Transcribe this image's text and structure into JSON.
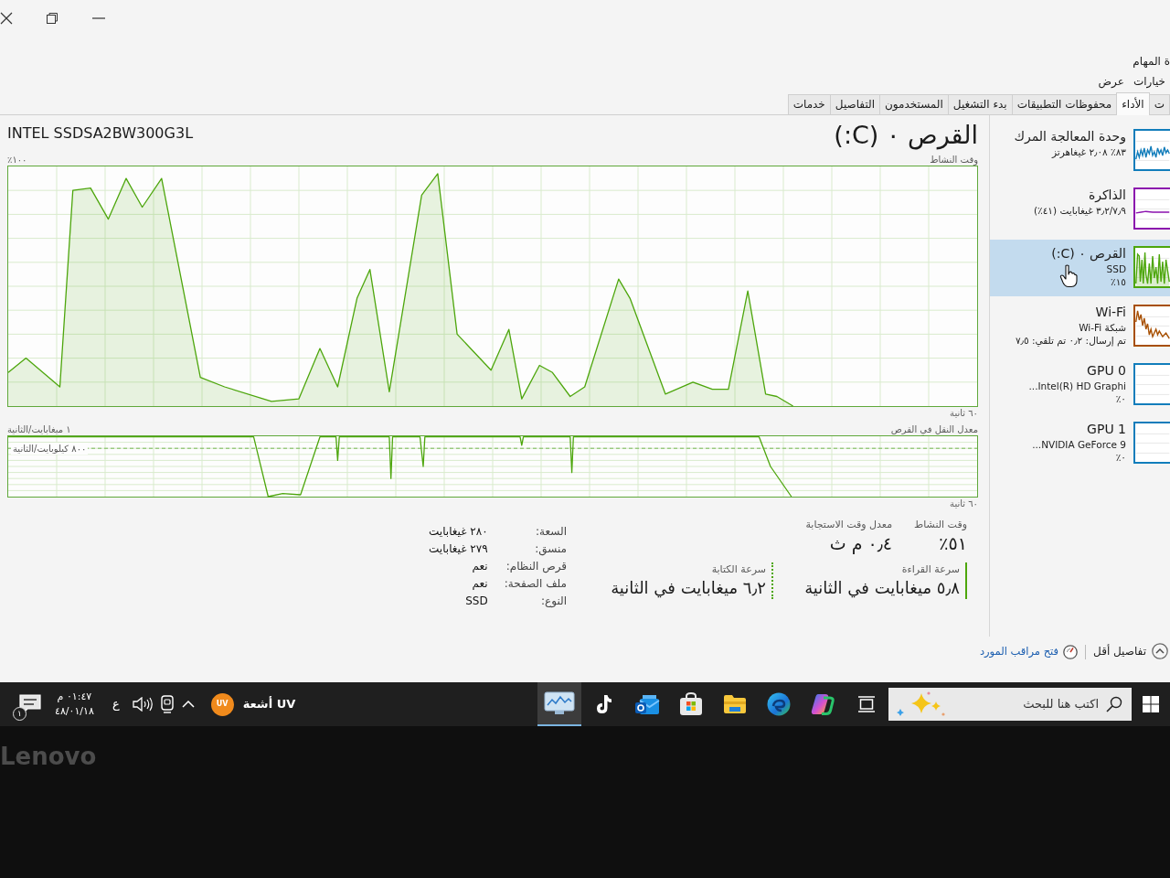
{
  "window": {
    "title": "ة المهام"
  },
  "menu": [
    {
      "label": "خيارات"
    },
    {
      "label": "عرض"
    }
  ],
  "tabs": [
    {
      "label": "ت",
      "selected": false
    },
    {
      "label": "الأداء",
      "selected": true
    },
    {
      "label": "محفوظات التطبيقات",
      "selected": false
    },
    {
      "label": "بدء التشغيل",
      "selected": false
    },
    {
      "label": "المستخدمون",
      "selected": false
    },
    {
      "label": "التفاصيل",
      "selected": false
    },
    {
      "label": "خدمات",
      "selected": false
    }
  ],
  "sidebar": {
    "items": [
      {
        "kind": "cpu",
        "title": "وحدة المعالجة المرك",
        "lines": [
          "٨٣٪ ٢٫٠٨ غيغاهرتز"
        ],
        "color": "#117dbb",
        "selected": false
      },
      {
        "kind": "memory",
        "title": "الذاكرة",
        "lines": [
          "٣٫٢/٧٫٩ غيغابايت (٤١٪)"
        ],
        "color": "#8b12ae",
        "selected": false
      },
      {
        "kind": "disk",
        "title": "القرص ٠ (C:)",
        "lines": [
          "SSD",
          "١٥٪"
        ],
        "color": "#4da60c",
        "selected": true
      },
      {
        "kind": "network",
        "title": "Wi-Fi",
        "lines": [
          "شبكة Wi-Fi",
          "تم إرسال: ٠٫٢ تم تلقي: ٧٫٥"
        ],
        "color": "#a74f01",
        "selected": false
      },
      {
        "kind": "gpu",
        "title": "GPU 0",
        "lines": [
          "Intel(R) HD Graphi...",
          "٠٪"
        ],
        "color": "#117dbb",
        "selected": false
      },
      {
        "kind": "gpu",
        "title": "GPU 1",
        "lines": [
          "NVIDIA GeForce 9...",
          "٠٪"
        ],
        "color": "#117dbb",
        "selected": false
      }
    ]
  },
  "panel": {
    "title": "القرص ٠ (C:)",
    "model": "INTEL SSDSA2BW300G3L",
    "activity_graph": {
      "title": "وقت النشاط",
      "scale_label": "١٠٠٪",
      "span_label": "٦٠ ثانية"
    },
    "transfer_graph": {
      "title": "معدل النقل في القرص",
      "scale_label": "١ ميغابايت/الثانية",
      "reference_label": "٨٠٠ كيلوبايت/الثانية",
      "span_label": "٦٠ ثانية"
    },
    "stats": [
      {
        "label": "وقت النشاط",
        "value": "٥١٪"
      },
      {
        "label": "معدل وقت الاستجابة",
        "value": "٠٫٤ م ث"
      }
    ],
    "speeds": [
      {
        "kind": "read",
        "label": "سرعة القراءة",
        "value": "٥٫٨ ميغابايت في الثانية"
      },
      {
        "kind": "write",
        "label": "سرعة الكتابة",
        "value": "٦٫٢ ميغابايت في الثانية"
      }
    ],
    "properties": [
      {
        "label": "السعة:",
        "value": "٢٨٠ غيغابايت"
      },
      {
        "label": "منسق:",
        "value": "٢٧٩ غيغابايت"
      },
      {
        "label": "قرص النظام:",
        "value": "نعم"
      },
      {
        "label": "ملف الصفحة:",
        "value": "نعم"
      },
      {
        "label": "النوع:",
        "value": "SSD"
      }
    ]
  },
  "footer": {
    "fewer_details": "تفاصيل أقل",
    "resource_monitor": "فتح مراقب المورد"
  },
  "taskbar": {
    "search": {
      "placeholder": "اكتب هنا للبحث"
    },
    "apps": [
      {
        "kind": "taskview",
        "selected": false
      },
      {
        "kind": "assistant",
        "selected": false
      },
      {
        "kind": "browser",
        "selected": false
      },
      {
        "kind": "files",
        "selected": false
      },
      {
        "kind": "store",
        "selected": false
      },
      {
        "kind": "mail",
        "selected": false
      },
      {
        "kind": "video",
        "selected": false
      },
      {
        "kind": "monitor",
        "selected": true
      }
    ],
    "weather": {
      "label": "أشعة UV",
      "badge": "UV"
    },
    "language": "ع",
    "clock": {
      "time": "٠١:٤٧ م",
      "date": "٤٨/٠١/١٨"
    },
    "notifications": {
      "count": "١"
    }
  },
  "bezel": {
    "logo": "Lenovo"
  }
}
